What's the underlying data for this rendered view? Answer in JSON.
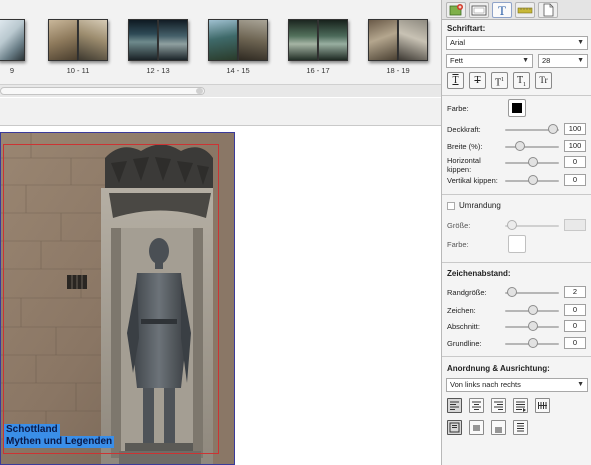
{
  "thumbnails": [
    {
      "label": "9"
    },
    {
      "label": "10 - 11"
    },
    {
      "label": "12 - 13"
    },
    {
      "label": "14 - 15"
    },
    {
      "label": "16 - 17"
    },
    {
      "label": "18 - 19"
    }
  ],
  "canvas": {
    "overlay_line1": "Schottland",
    "overlay_line2": "Mythen und Legenden"
  },
  "panel": {
    "tabs": [
      "add-image-icon",
      "frame-icon",
      "text-icon",
      "ruler-icon",
      "page-icon"
    ],
    "font_section": {
      "title": "Schriftart:",
      "font_family": "Arial",
      "font_style": "Fett",
      "font_size": "28",
      "format_buttons": [
        "T",
        "T",
        "T",
        "T",
        "Tr"
      ]
    },
    "color_label": "Farbe:",
    "text_color": "#000000",
    "opacity_label": "Deckkraft:",
    "opacity_value": "100",
    "width_label": "Breite (%):",
    "width_value": "100",
    "hflip_label": "Horizontal kippen:",
    "hflip_value": "0",
    "vflip_label": "Vertikal kippen:",
    "vflip_value": "0",
    "border_section": {
      "checkbox_label": "Umrandung",
      "size_label": "Größe:",
      "color_label": "Farbe:"
    },
    "spacing_section": {
      "title": "Zeichenabstand:",
      "margin_label": "Randgröße:",
      "margin_value": "2",
      "char_label": "Zeichen:",
      "char_value": "0",
      "para_label": "Abschnitt:",
      "para_value": "0",
      "baseline_label": "Grundline:",
      "baseline_value": "0"
    },
    "arrangement_section": {
      "title": "Anordnung & Ausrichtung:",
      "direction": "Von links nach rechts"
    }
  }
}
